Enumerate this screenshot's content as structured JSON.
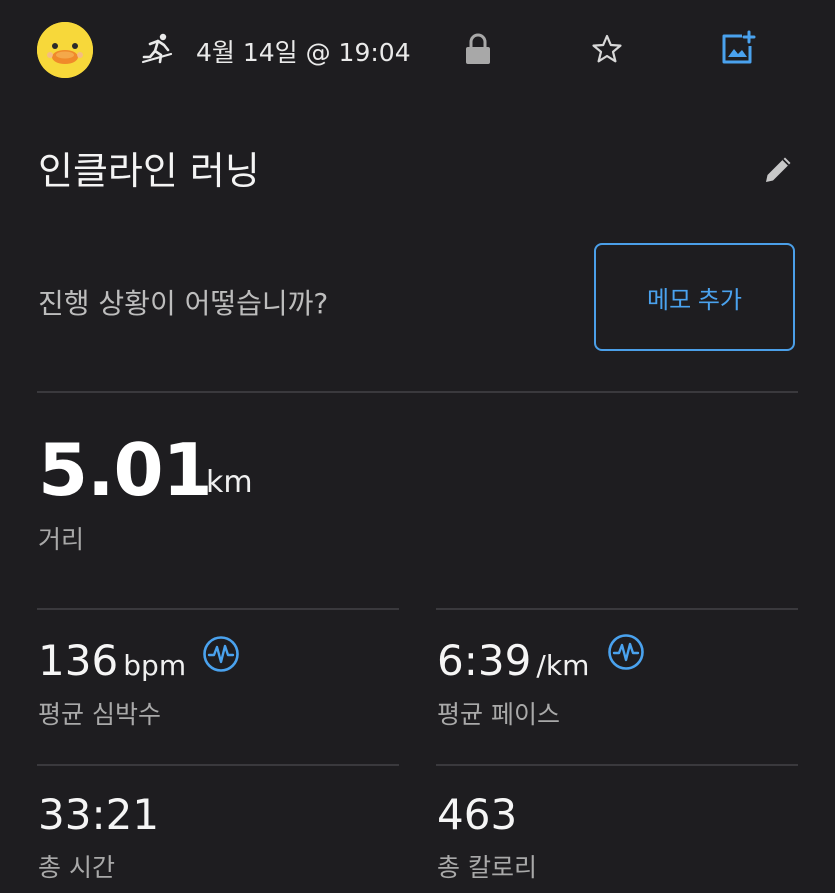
{
  "header": {
    "datetime": "4월 14일 @ 19:04"
  },
  "icons": {
    "avatar": "duck-avatar",
    "activity": "running-icon",
    "lock": "lock-icon",
    "star": "star-icon",
    "add_photo": "add-photo-icon",
    "edit": "pencil-icon",
    "heart_rate": "heart-rate-icon"
  },
  "activity": {
    "title": "인클라인 러닝",
    "prompt": "진행 상황이 어떻습니까?",
    "memo_button": "메모 추가"
  },
  "distance": {
    "value": "5.01",
    "unit": "km",
    "label": "거리"
  },
  "stats": {
    "heart_rate": {
      "value": "136",
      "unit": "bpm",
      "label": "평균 심박수"
    },
    "pace": {
      "value": "6:39",
      "unit": "/km",
      "label": "평균 페이스"
    },
    "time": {
      "value": "33:21",
      "label": "총 시간"
    },
    "calories": {
      "value": "463",
      "label": "총 칼로리"
    }
  },
  "colors": {
    "background": "#1e1d20",
    "accent_blue": "#4aa2ee",
    "avatar_yellow": "#f7d83a",
    "divider": "#3a393d"
  }
}
